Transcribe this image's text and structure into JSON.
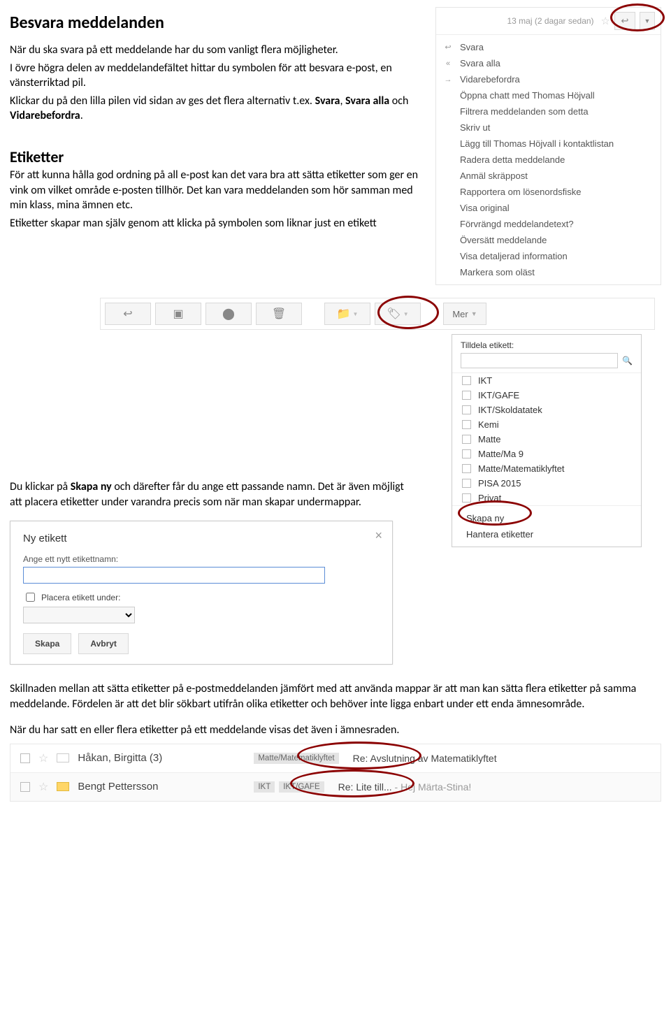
{
  "doc": {
    "h_besvara": "Besvara meddelanden",
    "p_besvara_1": "När du ska svara på ett meddelande har du som vanligt flera möjligheter.",
    "p_besvara_2": "I övre högra delen av meddelandefältet hittar du symbolen för att besvara e-post, en vänsterriktad pil.",
    "p_besvara_3a": "Klickar du på den lilla pilen vid sidan av ges det flera alternativ t.ex. ",
    "p_besvara_3b": "Svara",
    "p_besvara_3c": ", ",
    "p_besvara_3d": "Svara alla",
    "p_besvara_3e": " och ",
    "p_besvara_3f": "Vidarebefordra",
    "p_besvara_3g": ".",
    "h_etiketter": "Etiketter",
    "p_etik_1": "För att kunna hålla god ordning på all e-post kan det vara bra att sätta etiketter som ger en vink om vilket område e-posten tillhör. Det kan vara meddelanden som hör samman med min klass, mina ämnen etc.",
    "p_etik_2": "Etiketter skapar man själv genom att klicka på symbolen som liknar just en etikett",
    "p_skapa_1a": "Du klickar på ",
    "p_skapa_1b": "Skapa ny",
    "p_skapa_1c": " och därefter får du ange ett passande namn. Det är även möjligt att placera etiketter under varandra precis som när man skapar undermappar.",
    "p_skillnad": "Skillnaden mellan att sätta etiketter på e-postmeddelanden jämfört med att använda mappar är att man kan sätta flera etiketter på samma meddelande. Fördelen är att det blir sökbart utifrån olika etiketter och behöver inte ligga enbart under ett enda ämnesområde.",
    "p_visas": "När du har satt en eller flera etiketter på ett meddelande visas det även i ämnesraden."
  },
  "gm_menu": {
    "date": "13 maj (2 dagar sedan)",
    "items": [
      {
        "icon": "↩",
        "label": "Svara"
      },
      {
        "icon": "«",
        "label": "Svara alla"
      },
      {
        "icon": "→",
        "label": "Vidarebefordra"
      },
      {
        "icon": "",
        "label": "Öppna chatt med Thomas Höjvall"
      },
      {
        "icon": "",
        "label": "Filtrera meddelanden som detta"
      },
      {
        "icon": "",
        "label": "Skriv ut"
      },
      {
        "icon": "",
        "label": "Lägg till Thomas Höjvall i kontaktlistan"
      },
      {
        "icon": "",
        "label": "Radera detta meddelande"
      },
      {
        "icon": "",
        "label": "Anmäl skräppost"
      },
      {
        "icon": "",
        "label": "Rapportera om lösenordsfiske"
      },
      {
        "icon": "",
        "label": "Visa original"
      },
      {
        "icon": "",
        "label": "Förvrängd meddelandetext?"
      },
      {
        "icon": "",
        "label": "Översätt meddelande"
      },
      {
        "icon": "",
        "label": "Visa detaljerad information"
      },
      {
        "icon": "",
        "label": "Markera som oläst"
      }
    ]
  },
  "toolbar": {
    "more": "Mer"
  },
  "label_panel": {
    "header": "Tilldela etikett:",
    "labels": [
      "IKT",
      "IKT/GAFE",
      "IKT/Skoldatatek",
      "Kemi",
      "Matte",
      "Matte/Ma 9",
      "Matte/Matematiklyftet",
      "PISA 2015",
      "Privat"
    ],
    "create": "Skapa ny",
    "manage": "Hantera etiketter"
  },
  "dialog": {
    "title": "Ny etikett",
    "label_name": "Ange ett nytt etikettnamn:",
    "place_under": "Placera etikett under:",
    "create": "Skapa",
    "cancel": "Avbryt"
  },
  "inbox": {
    "rows": [
      {
        "sender": "Håkan, Birgitta (3)",
        "chips": [
          "Matte/Matematiklyftet"
        ],
        "subject": "Re: Avslutning av Matematiklyftet",
        "yellow": false
      },
      {
        "sender": "Bengt Pettersson",
        "chips": [
          "IKT",
          "IKT/GAFE"
        ],
        "subject": "Re: Lite till...",
        "grey": " - Hej Märta-Stina!",
        "yellow": true
      }
    ]
  }
}
